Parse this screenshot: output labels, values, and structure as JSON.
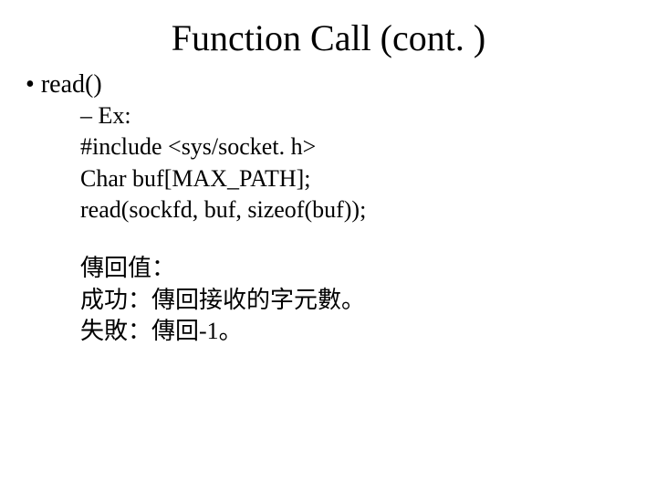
{
  "title": "Function Call (cont. )",
  "bullet1": "read()",
  "ex_label": "Ex:",
  "code": {
    "line1": "#include <sys/socket. h>",
    "line2": "Char buf[MAX_PATH];",
    "line3": "read(sockfd, buf, sizeof(buf));"
  },
  "ret": {
    "heading": "傳回值：",
    "success": "成功：傳回接收的字元數。",
    "fail": "失敗：傳回-1。"
  }
}
